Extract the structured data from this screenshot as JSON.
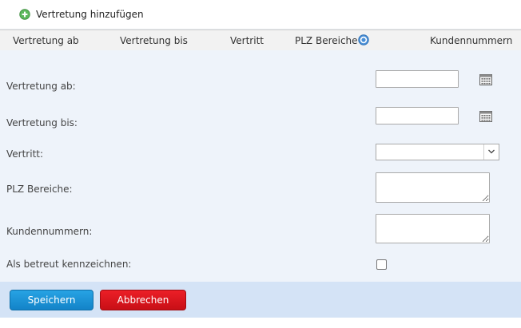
{
  "toolbar": {
    "add_label": "Vertretung hinzufügen",
    "add_icon": "plus-circle-icon",
    "add_icon_color": "#5cb85c"
  },
  "columns": {
    "von": "Vertretung ab",
    "bis": "Vertretung bis",
    "vertritt": "Vertritt",
    "plz": "PLZ Bereiche",
    "kunden": "Kundennummern",
    "help_icon": "help-icon",
    "help_icon_color": "#4a8fd6"
  },
  "form": {
    "von_label": "Vertretung ab:",
    "von_value": "",
    "bis_label": "Vertretung bis:",
    "bis_value": "",
    "vertritt_label": "Vertritt:",
    "vertritt_value": "",
    "plz_label": "PLZ Bereiche:",
    "plz_value": "",
    "kunden_label": "Kundennummern:",
    "kunden_value": "",
    "betreut_label": "Als betreut kennzeichnen:",
    "betreut_checked": false,
    "calendar_icon": "calendar-icon",
    "dropdown_icon": "chevron-down-icon"
  },
  "buttons": {
    "save": "Speichern",
    "cancel": "Abbrechen",
    "save_color": "#1a90d6",
    "cancel_color": "#e0161e"
  }
}
